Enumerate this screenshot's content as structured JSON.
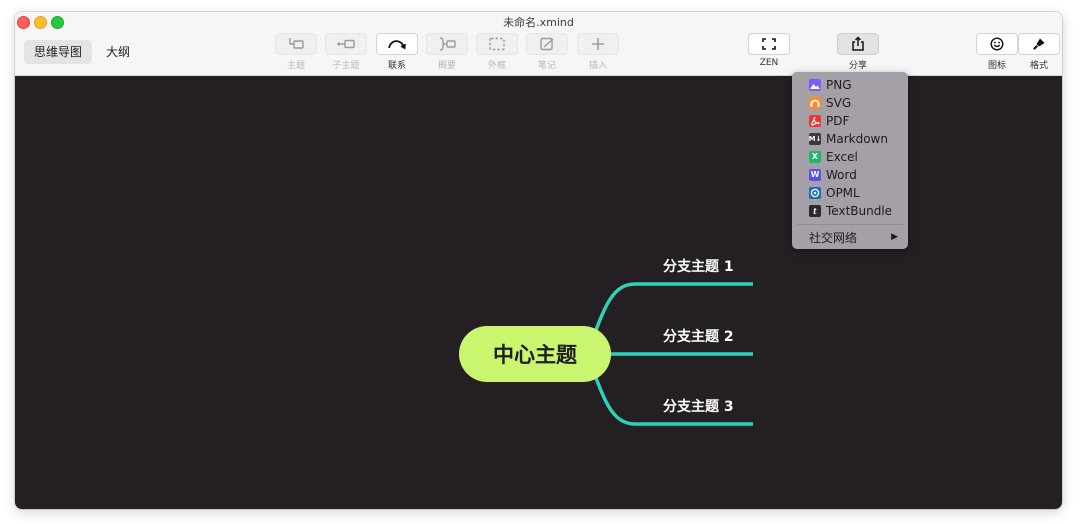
{
  "window": {
    "title": "未命名.xmind"
  },
  "view_switch": {
    "mind_map": "思维导图",
    "outline": "大纲"
  },
  "toolbar": {
    "topic": "主题",
    "subtopic": "子主题",
    "relationship": "联系",
    "summary": "概要",
    "boundary": "外框",
    "note": "笔记",
    "insert": "插入",
    "zen": "ZEN",
    "share": "分享",
    "icon": "图标",
    "format": "格式"
  },
  "mindmap": {
    "central_topic": "中心主题",
    "branches": [
      "分支主题 1",
      "分支主题 2",
      "分支主题 3"
    ],
    "central_color": "#c9f56f",
    "branch_line_color": "#2ed3b7",
    "canvas_color": "#231f22"
  },
  "share_menu": {
    "items": [
      {
        "label": "PNG",
        "icon": "image-icon",
        "color": "#7c5cff"
      },
      {
        "label": "SVG",
        "icon": "svg-icon",
        "color": "#ff8a1f"
      },
      {
        "label": "PDF",
        "icon": "pdf-icon",
        "color": "#e8393a"
      },
      {
        "label": "Markdown",
        "icon": "markdown-icon",
        "color": "#3a3a3a"
      },
      {
        "label": "Excel",
        "icon": "excel-icon",
        "color": "#1fb86a"
      },
      {
        "label": "Word",
        "icon": "word-icon",
        "color": "#5a4ff0"
      },
      {
        "label": "OPML",
        "icon": "opml-icon",
        "color": "#1b6fb8"
      },
      {
        "label": "TextBundle",
        "icon": "textbundle-icon",
        "color": "#2b2b2b"
      }
    ],
    "social": "社交网络",
    "icon_glyphs": {
      "markdown": "M↓",
      "excel": "X",
      "word": "W",
      "textbundle": "t"
    }
  }
}
